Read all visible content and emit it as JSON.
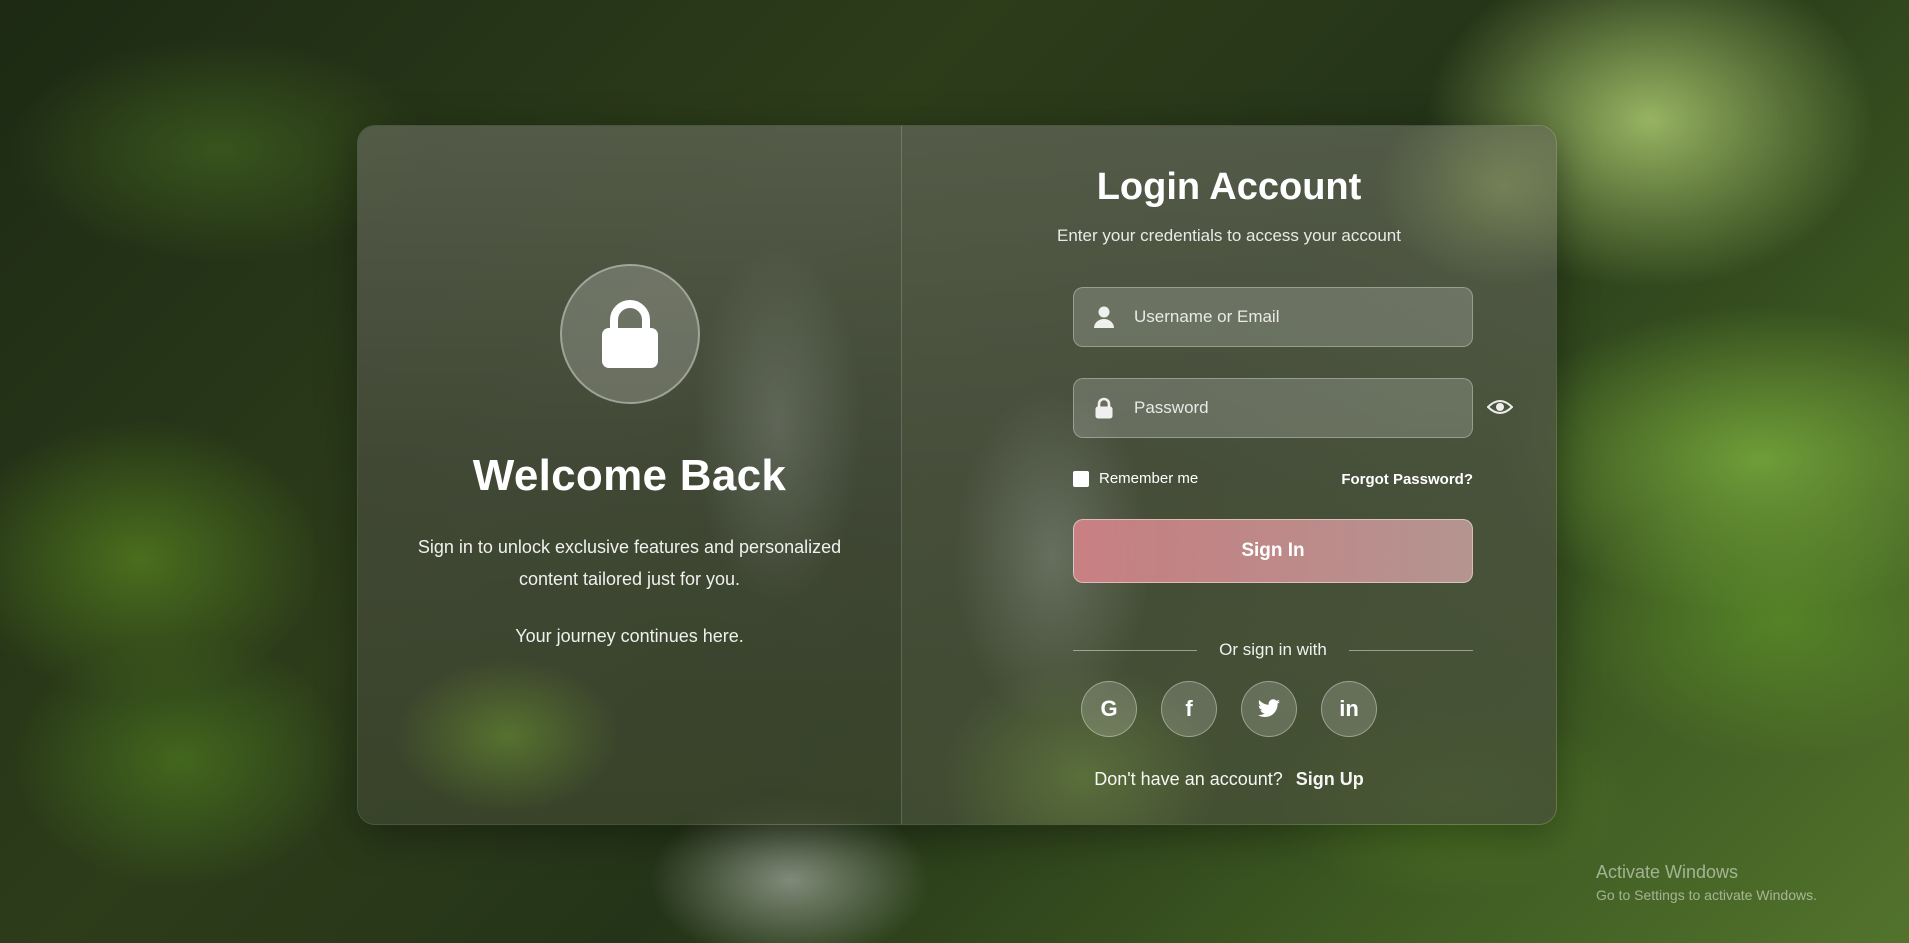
{
  "welcome": {
    "title": "Welcome Back",
    "text": "Sign in to unlock exclusive features and personalized content tailored just for you.",
    "subtext": "Your journey continues here."
  },
  "login": {
    "title": "Login Account",
    "subtitle": "Enter your credentials to access your account",
    "username_placeholder": "Username or Email",
    "password_placeholder": "Password",
    "remember_label": "Remember me",
    "forgot_label": "Forgot Password?",
    "signin_label": "Sign In",
    "divider_label": "Or sign in with",
    "social": {
      "google": "G",
      "facebook": "f",
      "linkedin": "in"
    },
    "signup_prompt": "Don't have an account?",
    "signup_label": "Sign Up"
  },
  "watermark": {
    "line1": "Activate Windows",
    "line2": "Go to Settings to activate Windows."
  },
  "icons": {
    "lock": "lock-icon",
    "user": "user-icon",
    "password_lock": "lock-icon",
    "eye": "eye-icon",
    "google": "google-icon",
    "facebook": "facebook-icon",
    "twitter": "twitter-icon",
    "linkedin": "linkedin-icon"
  },
  "colors": {
    "signin_button": "#d2878b",
    "text": "#ffffff"
  }
}
